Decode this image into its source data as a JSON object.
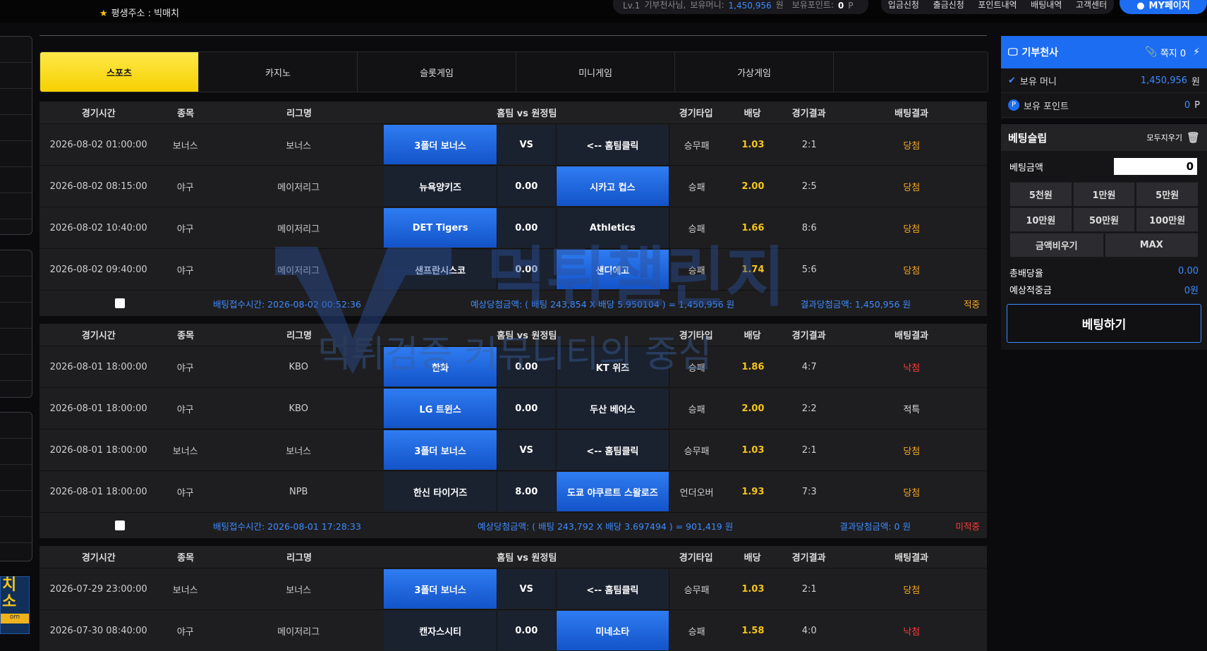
{
  "header": {
    "permanent_address": "평생주소 : 빅매치",
    "user": {
      "level": "Lv.1",
      "nickname": "기부천사님,",
      "money_label": "보유머니:",
      "money_value": "1,450,956",
      "money_unit": "원",
      "point_label": "보유포인트:",
      "point_value": "0",
      "point_unit": "P"
    },
    "menu": [
      "입금신청",
      "출금신청",
      "포인트내역",
      "배팅내역",
      "고객센터"
    ],
    "mypage_label": "MY페이지"
  },
  "tabs": [
    {
      "label": "스포츠",
      "active": true
    },
    {
      "label": "카지노",
      "active": false
    },
    {
      "label": "슬롯게임",
      "active": false
    },
    {
      "label": "미니게임",
      "active": false
    },
    {
      "label": "가상게임",
      "active": false
    }
  ],
  "table_headers": [
    "경기시간",
    "종목",
    "리그명",
    "홈팀 vs 원정팀",
    "경기타입",
    "배당",
    "경기결과",
    "배팅결과"
  ],
  "bets": [
    {
      "rows": [
        {
          "time": "2026-08-02 01:00:00",
          "sport": "보너스",
          "league": "보너스",
          "home": "3폴더 보너스",
          "mid": "VS",
          "away": "<-- 홈팀클릭",
          "sel": "home",
          "type": "승무패",
          "odds": "1.03",
          "result": "2:1",
          "bet_result": "당첨",
          "res_class": "win"
        },
        {
          "time": "2026-08-02 08:15:00",
          "sport": "야구",
          "league": "메이저리그",
          "home": "뉴욕양키즈",
          "mid": "0.00",
          "away": "시카고 컵스",
          "sel": "away",
          "type": "승패",
          "odds": "2.00",
          "result": "2:5",
          "bet_result": "당첨",
          "res_class": "win"
        },
        {
          "time": "2026-08-02 10:40:00",
          "sport": "야구",
          "league": "메이저리그",
          "home": "DET Tigers",
          "mid": "0.00",
          "away": "Athletics",
          "sel": "home",
          "type": "승패",
          "odds": "1.66",
          "result": "8:6",
          "bet_result": "당첨",
          "res_class": "win"
        },
        {
          "time": "2026-08-02 09:40:00",
          "sport": "야구",
          "league": "메이저리그",
          "home": "샌프란시스코",
          "mid": "0.00",
          "away": "샌디에고",
          "sel": "away",
          "type": "승패",
          "odds": "1.74",
          "result": "5:6",
          "bet_result": "당첨",
          "res_class": "win"
        }
      ],
      "footer": {
        "bet_time": "배팅접수시간: 2026-08-02 00:52:36",
        "expected": "예상당첨금액: ( 배팅 243,854 X 배당 5.950104 ) = 1,450,956 원",
        "actual": "결과당첨금액: 1,450,956 원",
        "status": "적중",
        "status_class": "orange"
      }
    },
    {
      "rows": [
        {
          "time": "2026-08-01 18:00:00",
          "sport": "야구",
          "league": "KBO",
          "home": "한화",
          "mid": "0.00",
          "away": "KT 위즈",
          "sel": "home",
          "type": "승패",
          "odds": "1.86",
          "result": "4:7",
          "bet_result": "낙첨",
          "res_class": "lose"
        },
        {
          "time": "2026-08-01 18:00:00",
          "sport": "야구",
          "league": "KBO",
          "home": "LG 트윈스",
          "mid": "0.00",
          "away": "두산 베어스",
          "sel": "home",
          "type": "승패",
          "odds": "2.00",
          "result": "2:2",
          "bet_result": "적특",
          "res_class": "refund"
        },
        {
          "time": "2026-08-01 18:00:00",
          "sport": "보너스",
          "league": "보너스",
          "home": "3폴더 보너스",
          "mid": "VS",
          "away": "<-- 홈팀클릭",
          "sel": "home",
          "type": "승무패",
          "odds": "1.03",
          "result": "2:1",
          "bet_result": "당첨",
          "res_class": "win"
        },
        {
          "time": "2026-08-01 18:00:00",
          "sport": "야구",
          "league": "NPB",
          "home": "한신 타이거즈",
          "mid": "8.00",
          "away": "도쿄 야쿠르트 스왈로즈",
          "sel": "away",
          "type": "언더오버",
          "odds": "1.93",
          "result": "7:3",
          "bet_result": "당첨",
          "res_class": "win"
        }
      ],
      "footer": {
        "bet_time": "배팅접수시간: 2026-08-01 17:28:33",
        "expected": "예상당첨금액: ( 배팅 243,792 X 배당 3.697494 ) = 901,419 원",
        "actual": "결과당첨금액: 0 원",
        "status": "미적중",
        "status_class": "red"
      }
    },
    {
      "rows": [
        {
          "time": "2026-07-29 23:00:00",
          "sport": "보너스",
          "league": "보너스",
          "home": "3폴더 보너스",
          "mid": "VS",
          "away": "<-- 홈팀클릭",
          "sel": "home",
          "type": "승무패",
          "odds": "1.03",
          "result": "2:1",
          "bet_result": "당첨",
          "res_class": "win"
        },
        {
          "time": "2026-07-30 08:40:00",
          "sport": "야구",
          "league": "메이저리그",
          "home": "캔자스시티",
          "mid": "0.00",
          "away": "미네소타",
          "sel": "away",
          "type": "승패",
          "odds": "1.58",
          "result": "4:0",
          "bet_result": "낙첨",
          "res_class": "lose"
        }
      ]
    }
  ],
  "sidebar": {
    "title": "기부천사",
    "memo_label": "쪽지 0",
    "money_label": "보유 머니",
    "money_value": "1,450,956",
    "money_unit": "원",
    "point_label": "보유 포인트",
    "point_value": "0",
    "point_unit": "P",
    "slip_title": "베팅슬립",
    "clear_all": "모두지우기",
    "amount_label": "베팅금액",
    "amount_value": "0",
    "amount_buttons": [
      "5천원",
      "1만원",
      "5만원",
      "10만원",
      "50만원",
      "100만원"
    ],
    "clear_amount": "금액비우기",
    "max_label": "MAX",
    "total_odds_label": "총배당율",
    "total_odds_value": "0.00",
    "expected_label": "예상적중금",
    "expected_value": "0원",
    "bet_button": "베팅하기"
  },
  "watermark": {
    "line1": "먹튀챌린지",
    "line2": "먹튀검증 커뮤니티의 중심"
  },
  "banner": {
    "line1": "치",
    "line2": "소",
    "bar": "om"
  },
  "colors": {
    "accent_blue": "#1d6df2",
    "tab_yellow": "#f5d000",
    "win": "#f5a623",
    "lose": "#ff3b3b",
    "odds": "#f5c518"
  }
}
